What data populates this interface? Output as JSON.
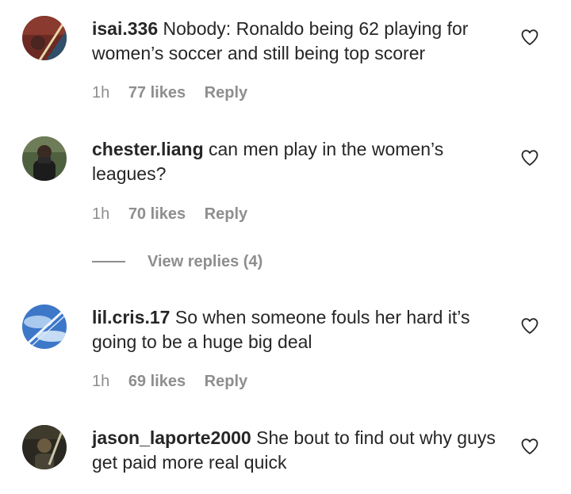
{
  "comments": [
    {
      "username": "isai.336",
      "text": "Nobody: Ronaldo being 62 playing for women’s soccer and still being top scorer",
      "time": "1h",
      "likes": "77 likes",
      "reply": "Reply",
      "avatar_colors": [
        "#6b2a24",
        "#2f4f6a"
      ],
      "icon": "heart-outline-icon"
    },
    {
      "username": "chester.liang",
      "text": "can men play in the women’s leagues?",
      "time": "1h",
      "likes": "70 likes",
      "reply": "Reply",
      "view_replies": "View replies (4)",
      "avatar_colors": [
        "#4f6040",
        "#1c1c1c"
      ],
      "icon": "heart-outline-icon"
    },
    {
      "username": "lil.cris.17",
      "text": "So when someone fouls her hard it’s going to be a huge big deal",
      "time": "1h",
      "likes": "69 likes",
      "reply": "Reply",
      "avatar_colors": [
        "#3d77c8",
        "#a9c9ee"
      ],
      "icon": "heart-outline-icon"
    },
    {
      "username": "jason_laporte2000",
      "text": "She bout to find out why guys get paid more real quick",
      "avatar_colors": [
        "#2a2820",
        "#c8c6a8"
      ],
      "icon": "heart-outline-icon"
    }
  ]
}
